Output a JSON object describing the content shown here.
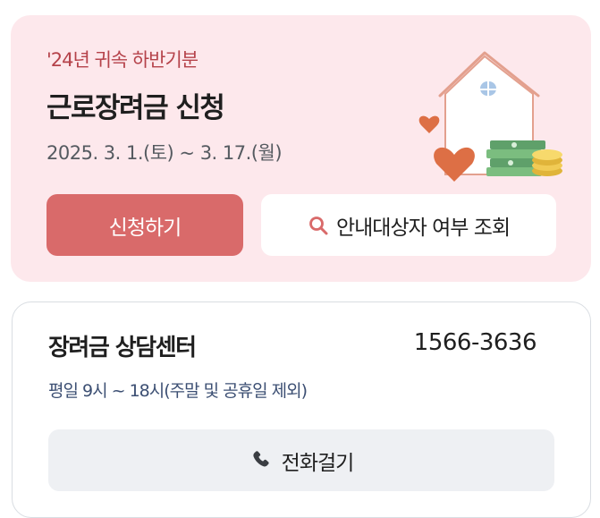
{
  "promo": {
    "subtitle": "'24년 귀속 하반기분",
    "title": "근로장려금 신청",
    "period": "2025. 3. 1.(토) ~ 3. 17.(월)",
    "apply_label": "신청하기",
    "lookup_label": "안내대상자 여부 조회",
    "lookup_icon": "search-icon",
    "illustration": "house-hearts-money-illustration",
    "colors": {
      "background": "#fde8ec",
      "accent_button": "#d96a6a",
      "subtitle": "#b5424a"
    }
  },
  "center": {
    "title": "장려금 상담센터",
    "phone": "1566-3636",
    "hours": "평일 9시 ~ 18시(주말 및 공휴일 제외)",
    "call_label": "전화걸기",
    "call_icon": "phone-icon",
    "colors": {
      "hours_text": "#3c4f73",
      "call_button": "#eef0f3"
    }
  }
}
